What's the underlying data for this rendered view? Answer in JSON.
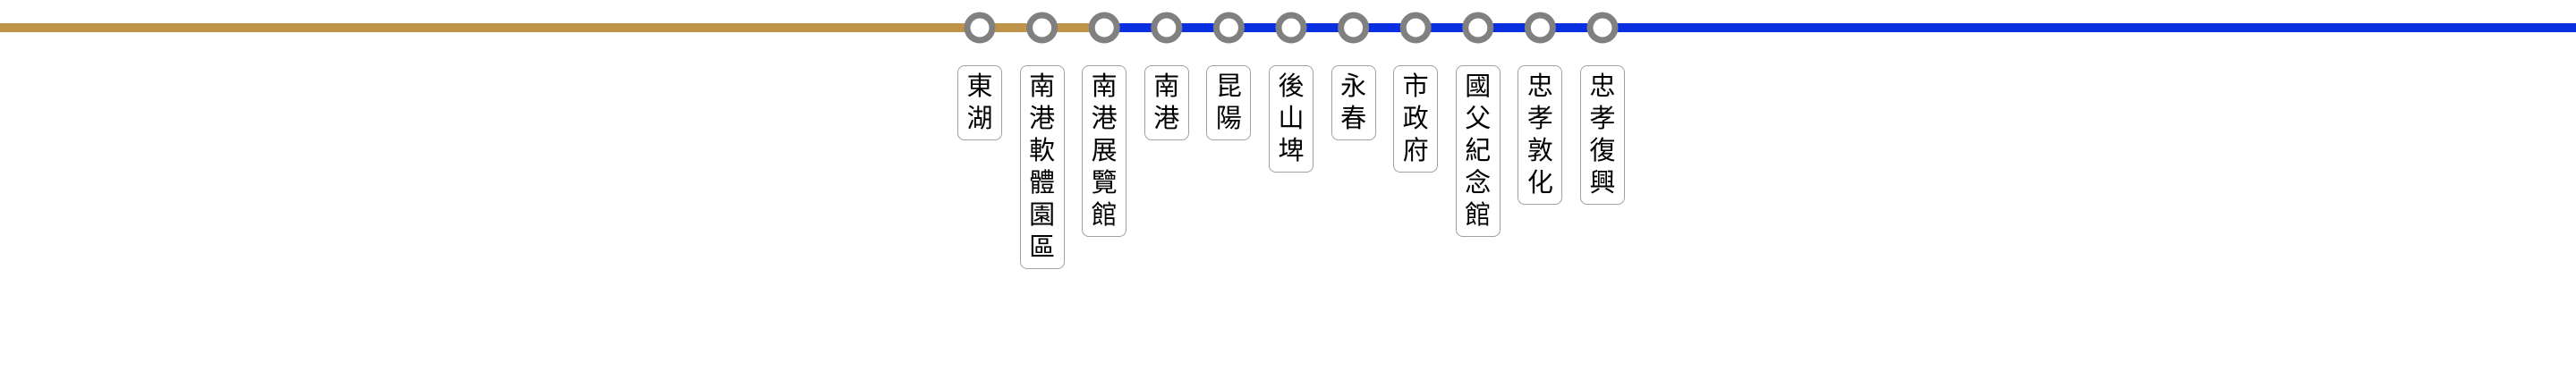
{
  "line_colors": {
    "left_segment": "#C0934B",
    "right_segment": "#0A2FE0"
  },
  "marker_colors": {
    "ring": "#808080",
    "fill": "#FFFFFF"
  },
  "stations": [
    {
      "id": "donghu",
      "name": "東湖",
      "segment": "left"
    },
    {
      "id": "nangang-software-park",
      "name": "南港軟體園區",
      "segment": "left"
    },
    {
      "id": "nangang-exhibition-center",
      "name": "南港展覽館",
      "segment": "junction"
    },
    {
      "id": "nangang",
      "name": "南港",
      "segment": "right"
    },
    {
      "id": "kunyang",
      "name": "昆陽",
      "segment": "right"
    },
    {
      "id": "houshanpi",
      "name": "後山埤",
      "segment": "right"
    },
    {
      "id": "yongchun",
      "name": "永春",
      "segment": "right"
    },
    {
      "id": "taipei-city-hall",
      "name": "市政府",
      "segment": "right"
    },
    {
      "id": "sun-yat-sen-memorial-hall",
      "name": "國父紀念館",
      "segment": "right"
    },
    {
      "id": "zhongxiao-dunhua",
      "name": "忠孝敦化",
      "segment": "right"
    },
    {
      "id": "zhongxiao-fuxing",
      "name": "忠孝復興",
      "segment": "right"
    }
  ]
}
